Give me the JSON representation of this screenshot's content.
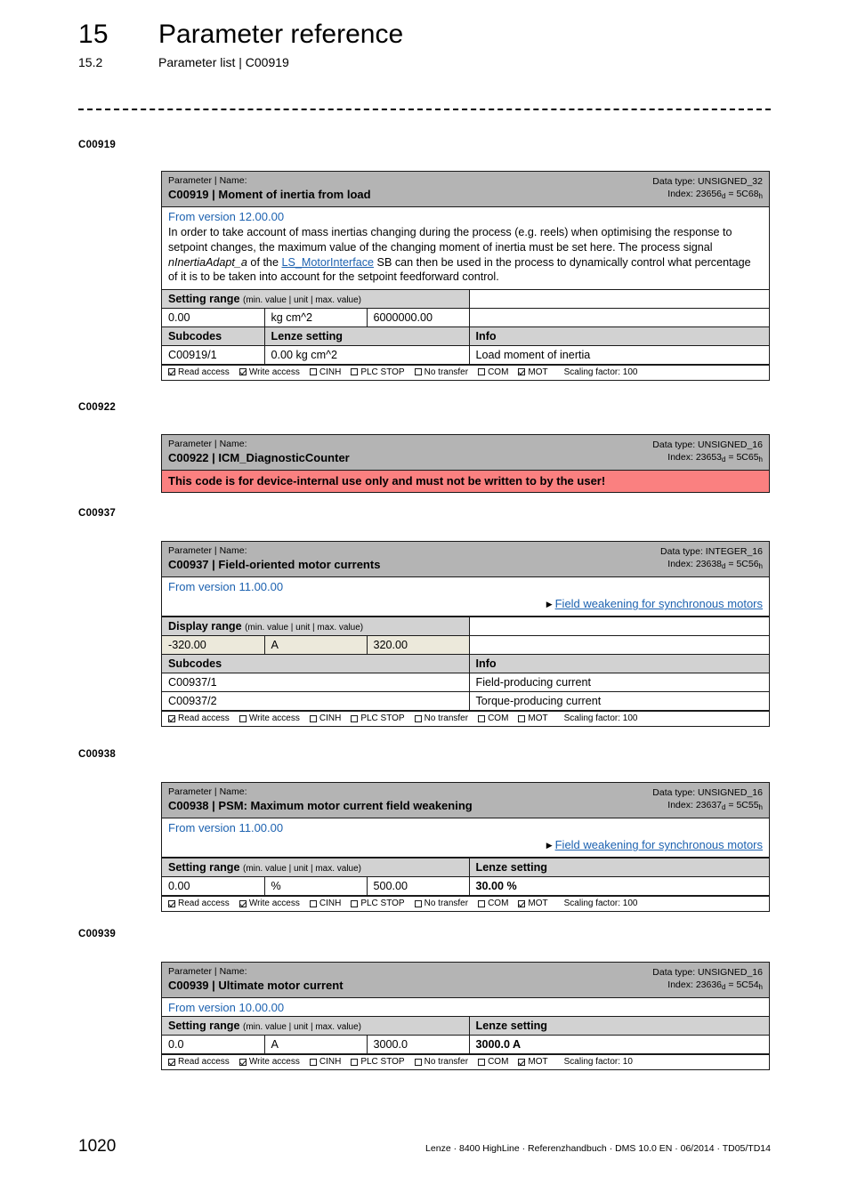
{
  "header": {
    "chapter_number": "15",
    "chapter_title": "Parameter reference",
    "section_number": "15.2",
    "section_title": "Parameter list | C00919"
  },
  "footer": {
    "page_number": "1020",
    "info": "Lenze · 8400 HighLine · Referenzhandbuch · DMS 10.0 EN · 06/2014 · TD05/TD14"
  },
  "labels": {
    "param_name_caption": "Parameter | Name:",
    "data_type_prefix": "Data type: ",
    "index_prefix": "Index: ",
    "setting_range": "Setting range",
    "display_range": "Display range",
    "range_sub": "(min. value | unit | max. value)",
    "subcodes": "Subcodes",
    "lenze_setting": "Lenze setting",
    "info": "Info",
    "read_access": "Read access",
    "write_access": "Write access",
    "cinh": "CINH",
    "plc_stop": "PLC STOP",
    "no_transfer": "No transfer",
    "com": "COM",
    "mot": "MOT",
    "scaling_prefix": "Scaling factor: ",
    "link_arrow": "▶"
  },
  "colors": {
    "header_gray": "#b4b4b4",
    "table_header_gray": "#d2d2d2",
    "beige": "#ece9db",
    "warning_red": "#fa8080",
    "link_blue": "#1d62b0"
  },
  "margin_labels": [
    "C00919",
    "C00922",
    "C00937",
    "C00938",
    "C00939"
  ],
  "blocks": [
    {
      "margin": "C00919",
      "code": "C00919",
      "name": "Moment of inertia from load",
      "title": "C00919 | Moment of inertia from load",
      "data_type": "UNSIGNED_32",
      "index_dec": "23656",
      "index_hex": "5C68",
      "version": "From version 12.00.00",
      "description_part1": "In order to take account of mass inertias changing during the process (e.g. reels) when optimising the response to setpoint changes, the maximum value of the changing moment of inertia must be set here. The process signal ",
      "description_italic": "nInertiaAdapt_a",
      "description_part2": " of the ",
      "description_link": "LS_MotorInterface",
      "description_part3": " SB can then be used in the process to dynamically control what percentage of it is to be taken into account for the setpoint feedforward control.",
      "range_label": "Setting range",
      "range_min": "0.00",
      "range_unit": "kg cm^2",
      "range_max": "6000000.00",
      "subcodes_header": "Subcodes",
      "second_col_header": "Lenze setting",
      "third_col_header": "Info",
      "subcode_rows": [
        {
          "subcode": "C00919/1",
          "setting": "0.00 kg cm^2",
          "info": "Load moment of inertia"
        }
      ],
      "access": {
        "read": true,
        "write": true,
        "cinh": false,
        "plc_stop": false,
        "no_transfer": false,
        "com": false,
        "mot": true,
        "scaling": "100"
      }
    },
    {
      "margin": "C00922",
      "code": "C00922",
      "name": "ICM_DiagnosticCounter",
      "title": "C00922 | ICM_DiagnosticCounter",
      "data_type": "UNSIGNED_16",
      "index_dec": "23653",
      "index_hex": "5C65",
      "warning": "This code is for device-internal use only and must not be written to by the user!"
    },
    {
      "margin": "C00937",
      "code": "C00937",
      "name": "Field-oriented motor currents",
      "title": "C00937 | Field-oriented motor currents",
      "data_type": "INTEGER_16",
      "index_dec": "23638",
      "index_hex": "5C56",
      "version": "From version 11.00.00",
      "link": "Field weakening for synchronous motors",
      "range_label": "Display range",
      "range_min": "-320.00",
      "range_unit": "A",
      "range_max": "320.00",
      "subcodes_header": "Subcodes",
      "third_col_header": "Info",
      "subcode_rows": [
        {
          "subcode": "C00937/1",
          "info": "Field-producing current"
        },
        {
          "subcode": "C00937/2",
          "info": "Torque-producing current"
        }
      ],
      "access": {
        "read": true,
        "write": false,
        "cinh": false,
        "plc_stop": false,
        "no_transfer": false,
        "com": false,
        "mot": false,
        "scaling": "100"
      }
    },
    {
      "margin": "C00938",
      "code": "C00938",
      "name": "PSM: Maximum motor current field weakening",
      "title": "C00938 | PSM: Maximum motor current field weakening",
      "data_type": "UNSIGNED_16",
      "index_dec": "23637",
      "index_hex": "5C55",
      "version": "From version 11.00.00",
      "link": "Field weakening for synchronous motors",
      "range_label": "Setting range",
      "range_min": "0.00",
      "range_unit": "%",
      "range_max": "500.00",
      "lenze_header": "Lenze setting",
      "lenze_value": "30.00 %",
      "access": {
        "read": true,
        "write": true,
        "cinh": false,
        "plc_stop": false,
        "no_transfer": false,
        "com": false,
        "mot": true,
        "scaling": "100"
      }
    },
    {
      "margin": "C00939",
      "code": "C00939",
      "name": "Ultimate motor current",
      "title": "C00939 | Ultimate motor current",
      "data_type": "UNSIGNED_16",
      "index_dec": "23636",
      "index_hex": "5C54",
      "version": "From version 10.00.00",
      "range_label": "Setting range",
      "range_min": "0.0",
      "range_unit": "A",
      "range_max": "3000.0",
      "lenze_header": "Lenze setting",
      "lenze_value": "3000.0 A",
      "access": {
        "read": true,
        "write": true,
        "cinh": false,
        "plc_stop": false,
        "no_transfer": false,
        "com": false,
        "mot": true,
        "scaling": "10"
      }
    }
  ]
}
